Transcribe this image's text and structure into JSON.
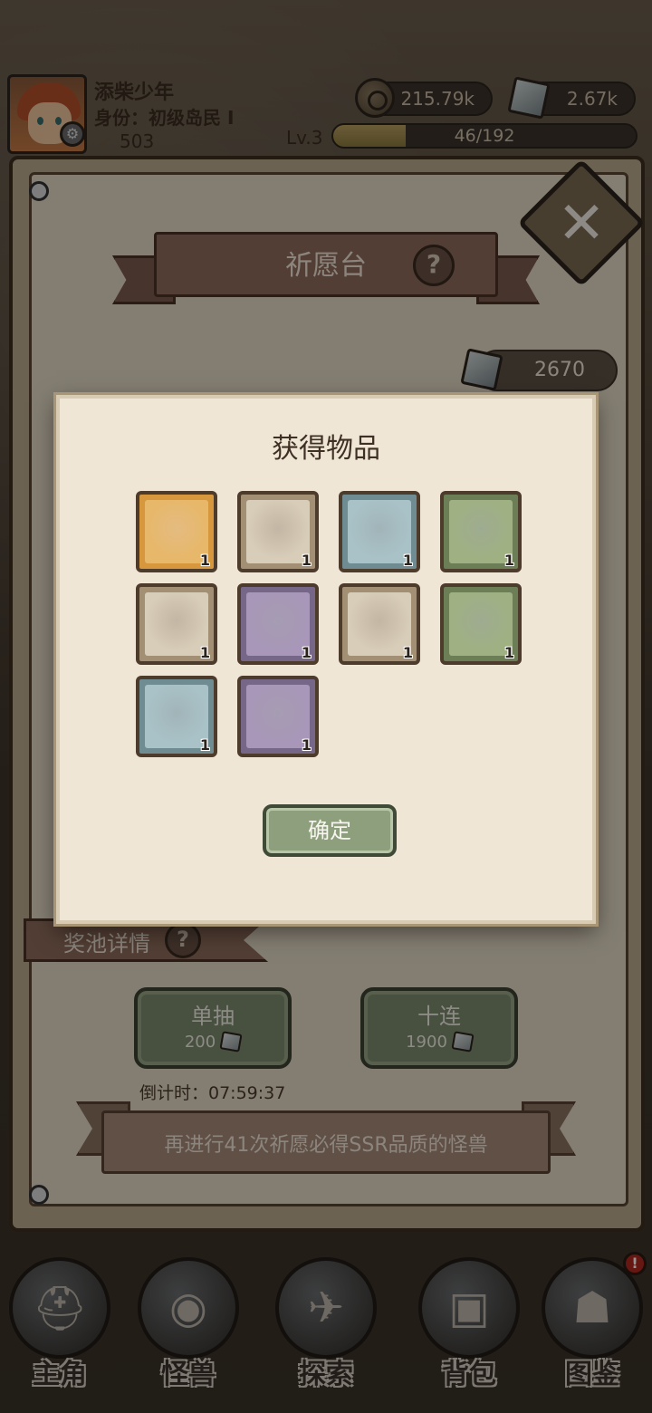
{
  "player": {
    "name": "添柴少年",
    "role": "身份：初级岛民 I",
    "power": "503",
    "level": "Lv.3",
    "xp_text": "46/192",
    "xp_progress": 0.24
  },
  "currency": {
    "coins": "215.79k",
    "gems": "2.67k"
  },
  "altar": {
    "title": "祈愿台",
    "help": "?",
    "gem_balance": "2670",
    "pool_details": "奖池详情",
    "single_draw": {
      "label": "单抽",
      "cost": "200"
    },
    "ten_draw": {
      "label": "十连",
      "cost": "1900"
    },
    "countdown": "倒计时：07:59:37",
    "guarantee_text": "再进行41次祈愿必得SSR品质的怪兽",
    "close_icon": "close-icon"
  },
  "reward_modal": {
    "title": "获得物品",
    "confirm_label": "确定",
    "items": [
      {
        "name": "girl-character",
        "count": "1",
        "frame": "#d6973d",
        "bg": "#e7b86a"
      },
      {
        "name": "mushroom-monster",
        "count": "1",
        "frame": "#a38f73",
        "bg": "#d8cdb8"
      },
      {
        "name": "rock-golem",
        "count": "1",
        "frame": "#6f8c93",
        "bg": "#a9c2c7"
      },
      {
        "name": "plant-monster",
        "count": "1",
        "frame": "#6b7e55",
        "bg": "#9fb183"
      },
      {
        "name": "dark-orb",
        "count": "1",
        "frame": "#a38f73",
        "bg": "#d8cdb8"
      },
      {
        "name": "toad-monster",
        "count": "1",
        "frame": "#766789",
        "bg": "#a897b8"
      },
      {
        "name": "chameleon-monster",
        "count": "1",
        "frame": "#a38f73",
        "bg": "#d8cdb8"
      },
      {
        "name": "axolotl-monster",
        "count": "1",
        "frame": "#6b7e55",
        "bg": "#9fb183"
      },
      {
        "name": "mimic-mouth-monster",
        "count": "1",
        "frame": "#6f8c93",
        "bg": "#a9c2c7"
      },
      {
        "name": "axolotl-monster-2",
        "count": "1",
        "frame": "#766789",
        "bg": "#a897b8"
      }
    ]
  },
  "nav": [
    {
      "label": "主角",
      "icon": "helmet-icon",
      "glyph": "⛑"
    },
    {
      "label": "怪兽",
      "icon": "monster-eye-icon",
      "glyph": "◉"
    },
    {
      "label": "探索",
      "icon": "map-scroll-icon",
      "glyph": "✈"
    },
    {
      "label": "背包",
      "icon": "backpack-icon",
      "glyph": "▣"
    },
    {
      "label": "图鉴",
      "icon": "book-icon",
      "glyph": "☗",
      "badge": "!"
    }
  ]
}
